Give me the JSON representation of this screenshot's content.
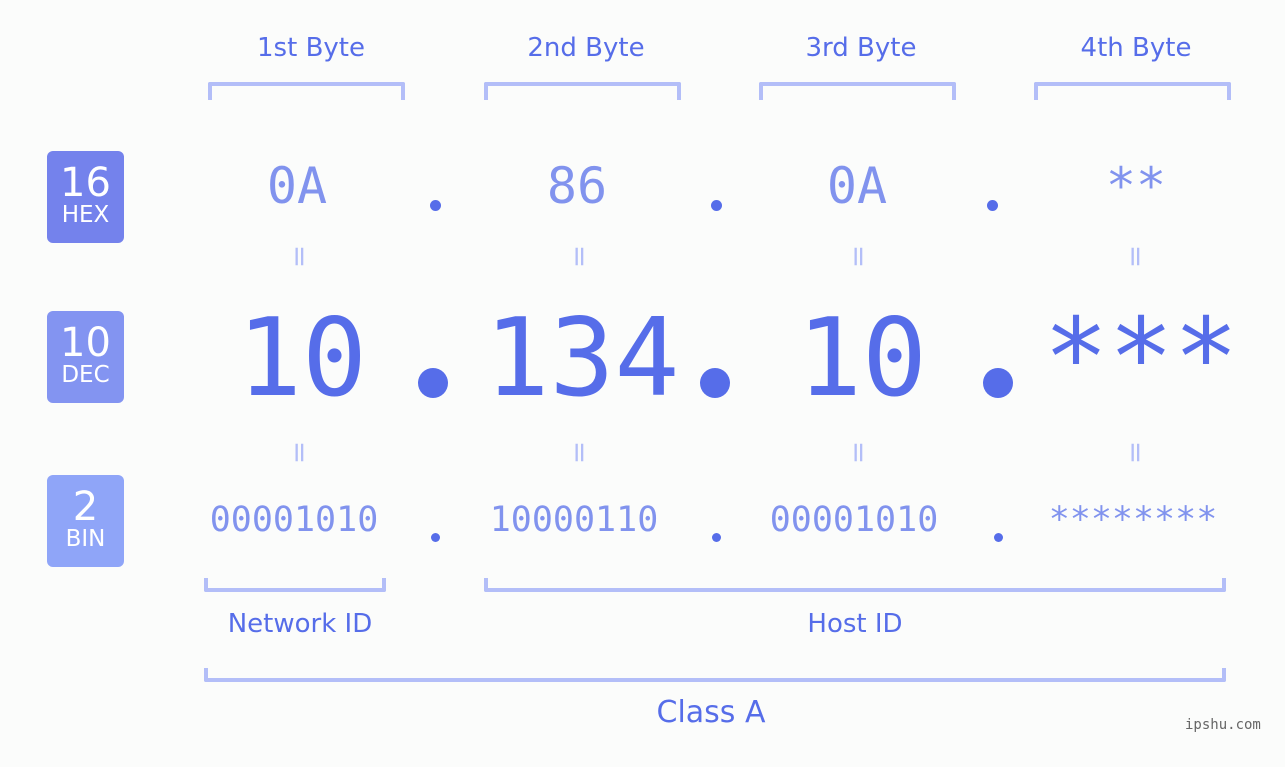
{
  "bytes": [
    {
      "header": "1st Byte",
      "hex": "0A",
      "dec": "10",
      "bin": "00001010"
    },
    {
      "header": "2nd Byte",
      "hex": "86",
      "dec": "134",
      "bin": "10000110"
    },
    {
      "header": "3rd Byte",
      "hex": "0A",
      "dec": "10",
      "bin": "00001010"
    },
    {
      "header": "4th Byte",
      "hex": "**",
      "dec": "***",
      "bin": "********"
    }
  ],
  "badges": {
    "hex": {
      "num": "16",
      "label": "HEX",
      "color": "#7482ec"
    },
    "dec": {
      "num": "10",
      "label": "DEC",
      "color": "#8394f1"
    },
    "bin": {
      "num": "2",
      "label": "BIN",
      "color": "#8fa5f8"
    }
  },
  "equals_sign": "=",
  "segments": {
    "network": "Network ID",
    "host": "Host ID",
    "class": "Class A"
  },
  "watermark": "ipshu.com",
  "colors": {
    "primary": "#566de9",
    "secondary": "#8193ee",
    "bracket": "#b3bef8",
    "background": "#fbfcfb"
  }
}
